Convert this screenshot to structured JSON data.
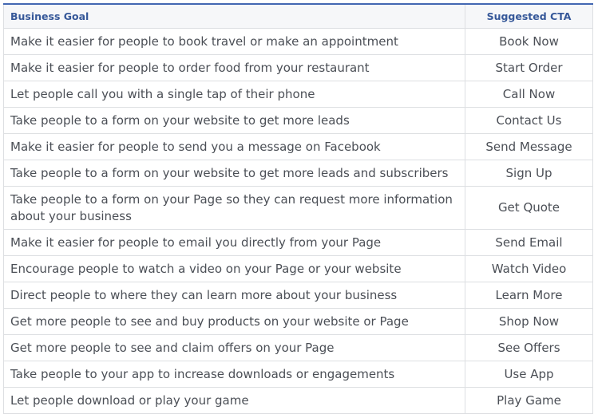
{
  "table": {
    "headers": {
      "goal": "Business Goal",
      "cta": "Suggested CTA"
    },
    "rows": [
      {
        "goal": "Make it easier for people to book travel or make an appointment",
        "cta": "Book Now"
      },
      {
        "goal": "Make it easier for people to order food from your restaurant",
        "cta": "Start Order"
      },
      {
        "goal": "Let people call you with a single tap of their phone",
        "cta": "Call Now"
      },
      {
        "goal": "Take people to a form on your website to get more leads",
        "cta": "Contact Us"
      },
      {
        "goal": "Make it easier for people to send you a message on Facebook",
        "cta": "Send Message"
      },
      {
        "goal": "Take people to a form on your website to get more leads and subscribers",
        "cta": "Sign Up"
      },
      {
        "goal": "Take people to a form on your Page so they can request more information about your business",
        "cta": "Get Quote"
      },
      {
        "goal": "Make it easier for people to email you directly from your Page",
        "cta": "Send Email"
      },
      {
        "goal": "Encourage people to watch a video on your Page or your website",
        "cta": "Watch Video"
      },
      {
        "goal": "Direct people to where they can learn more about your business",
        "cta": "Learn More"
      },
      {
        "goal": "Get more people to see and buy products on your website or Page",
        "cta": "Shop Now"
      },
      {
        "goal": "Get more people to see and claim offers on your Page",
        "cta": "See Offers"
      },
      {
        "goal": "Take people to your app to increase downloads or engagements",
        "cta": "Use App"
      },
      {
        "goal": "Let people download or play your game",
        "cta": "Play Game"
      }
    ]
  }
}
